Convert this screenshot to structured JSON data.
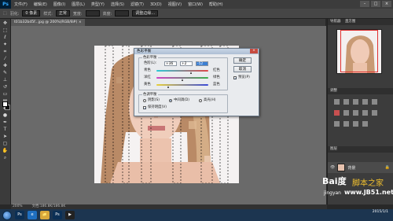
{
  "app": {
    "logo": "Ps"
  },
  "menu": [
    "文件(F)",
    "编辑(E)",
    "图像(I)",
    "图层(L)",
    "类型(Y)",
    "选择(S)",
    "滤镜(T)",
    "3D(D)",
    "视图(V)",
    "窗口(W)",
    "帮助(H)"
  ],
  "window_controls": [
    "–",
    "□",
    "×"
  ],
  "options": {
    "feather_label": "羽化:",
    "feather_value": "0 像素",
    "style_label": "样式:",
    "style_value": "正常",
    "width_label": "宽度:",
    "height_label": "高度:",
    "refine_label": "调整边缘..."
  },
  "doc_tab": "t01b32bd5f...jpg @ 200%(RGB/8#) ×",
  "panel": {
    "nav_tab": "导航器",
    "hist_tab": "直方图",
    "adj_tab": "调整",
    "layers_tab": "图层",
    "layer_name": "背景"
  },
  "status": {
    "zoom": "200%",
    "doc": "文档:186.8K/186.8K"
  },
  "dialog": {
    "title": "色彩平衡",
    "close": "×",
    "balance_legend": "色彩平衡",
    "levels_label": "色阶(L):",
    "levels": [
      "+36",
      "+2",
      "-52"
    ],
    "sliders": [
      {
        "left": "青色",
        "right": "红色",
        "value": 36
      },
      {
        "left": "洋红",
        "right": "绿色",
        "value": 2
      },
      {
        "left": "黄色",
        "right": "蓝色",
        "value": -52
      }
    ],
    "tone_legend": "色调平衡",
    "tones": [
      "阴影(S)",
      "中间调(D)",
      "高光(H)"
    ],
    "tone_selected": 1,
    "preserve": "保持明度(V)",
    "preview": "预览(P)",
    "ok": "确定",
    "cancel": "取消"
  },
  "taskbar": {
    "icons": [
      "Ps",
      "e",
      "📁",
      "Ps",
      "▶"
    ],
    "time": "",
    "date": "2015/1/1"
  },
  "watermark": {
    "logo": "Bai度",
    "sub": "jingyan",
    "site": "脚本之家",
    "url": "www.JB51.net"
  },
  "colors": {
    "cyan_red": "#e04848",
    "magenta_green": "#3ab04a",
    "yellow_blue": "#3a4ad8",
    "accent": "#1a5fb4"
  }
}
